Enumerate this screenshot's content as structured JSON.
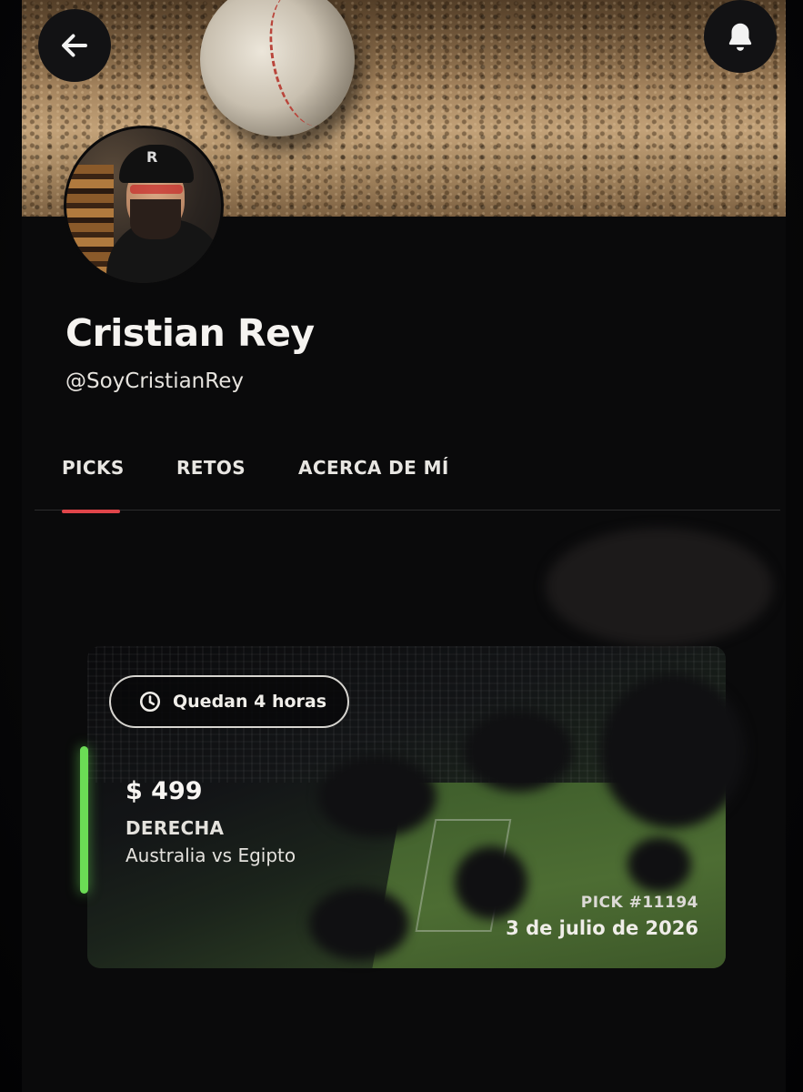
{
  "header": {
    "back_icon": "arrow-left-icon",
    "notification_icon": "bell-icon"
  },
  "profile": {
    "name": "Cristian Rey",
    "handle": "@SoyCristianRey",
    "avatar_cap_letter": "R"
  },
  "tabs": [
    {
      "label": "PICKS",
      "active": true
    },
    {
      "label": "RETOS",
      "active": false
    },
    {
      "label": "ACERCA DE MÍ",
      "active": false
    }
  ],
  "pick": {
    "time_left": "Quedan 4 horas",
    "price": "$ 499",
    "side": "DERECHA",
    "match": "Australia vs Egipto",
    "pick_id": "PICK #11194",
    "date": "3 de julio de 2026"
  },
  "colors": {
    "active_tab_underline": "#e0454a",
    "status_bar": "#6bdc55",
    "background": "#0a0a0b"
  }
}
